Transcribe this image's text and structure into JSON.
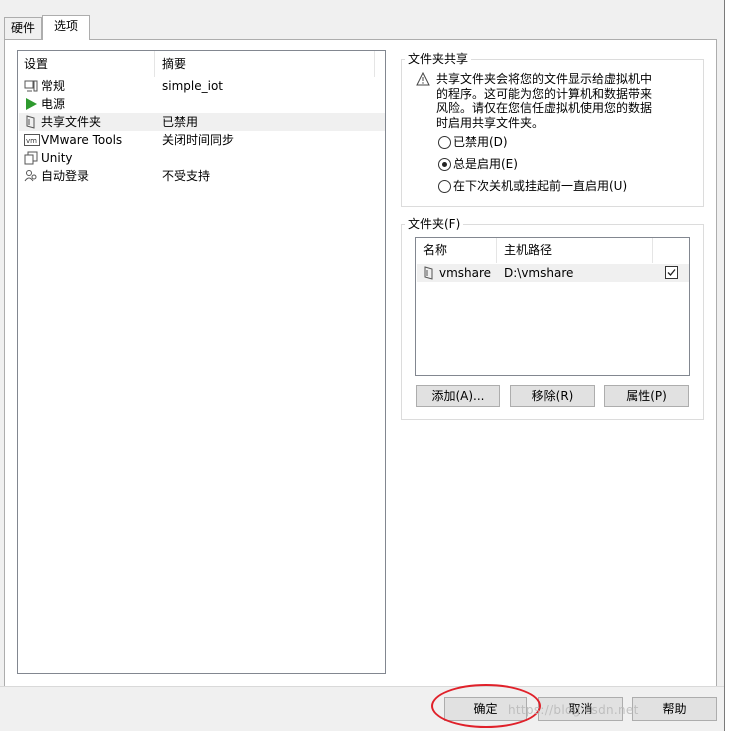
{
  "tabs": [
    {
      "label": "硬件"
    },
    {
      "label": "选项"
    }
  ],
  "settings_list": {
    "headers": {
      "setting": "设置",
      "summary": "摘要"
    },
    "rows": [
      {
        "name": "常规",
        "summary": "simple_iot",
        "icon": "monitor-icon"
      },
      {
        "name": "电源",
        "summary": "",
        "icon": "power-play-icon"
      },
      {
        "name": "共享文件夹",
        "summary": "已禁用",
        "icon": "shared-folder-icon"
      },
      {
        "name": "VMware Tools",
        "summary": "关闭时间同步",
        "icon": "vm-icon"
      },
      {
        "name": "Unity",
        "summary": "",
        "icon": "unity-icon"
      },
      {
        "name": "自动登录",
        "summary": "不受支持",
        "icon": "users-icon"
      }
    ]
  },
  "sharing": {
    "title": "文件夹共享",
    "warning_lines": [
      "共享文件夹会将您的文件显示给虚拟机中",
      "的程序。这可能为您的计算机和数据带来",
      "风险。请仅在您信任虚拟机使用您的数据",
      "时启用共享文件夹。"
    ],
    "options": [
      {
        "label": "已禁用(D)",
        "checked": false
      },
      {
        "label": "总是启用(E)",
        "checked": true
      },
      {
        "label": "在下次关机或挂起前一直启用(U)",
        "checked": false
      }
    ]
  },
  "folders": {
    "title": "文件夹(F)",
    "headers": {
      "name": "名称",
      "path": "主机路径"
    },
    "rows": [
      {
        "name": "vmshare",
        "path": "D:\\vmshare",
        "enabled": true
      }
    ],
    "buttons": {
      "add": "添加(A)...",
      "remove": "移除(R)",
      "properties": "属性(P)"
    }
  },
  "footer": {
    "ok": "确定",
    "cancel": "取消",
    "help": "帮助",
    "watermark": "https://blog.csdn.net"
  },
  "colors": {
    "highlight": "#e0212a",
    "power": "#2e9a2e"
  }
}
